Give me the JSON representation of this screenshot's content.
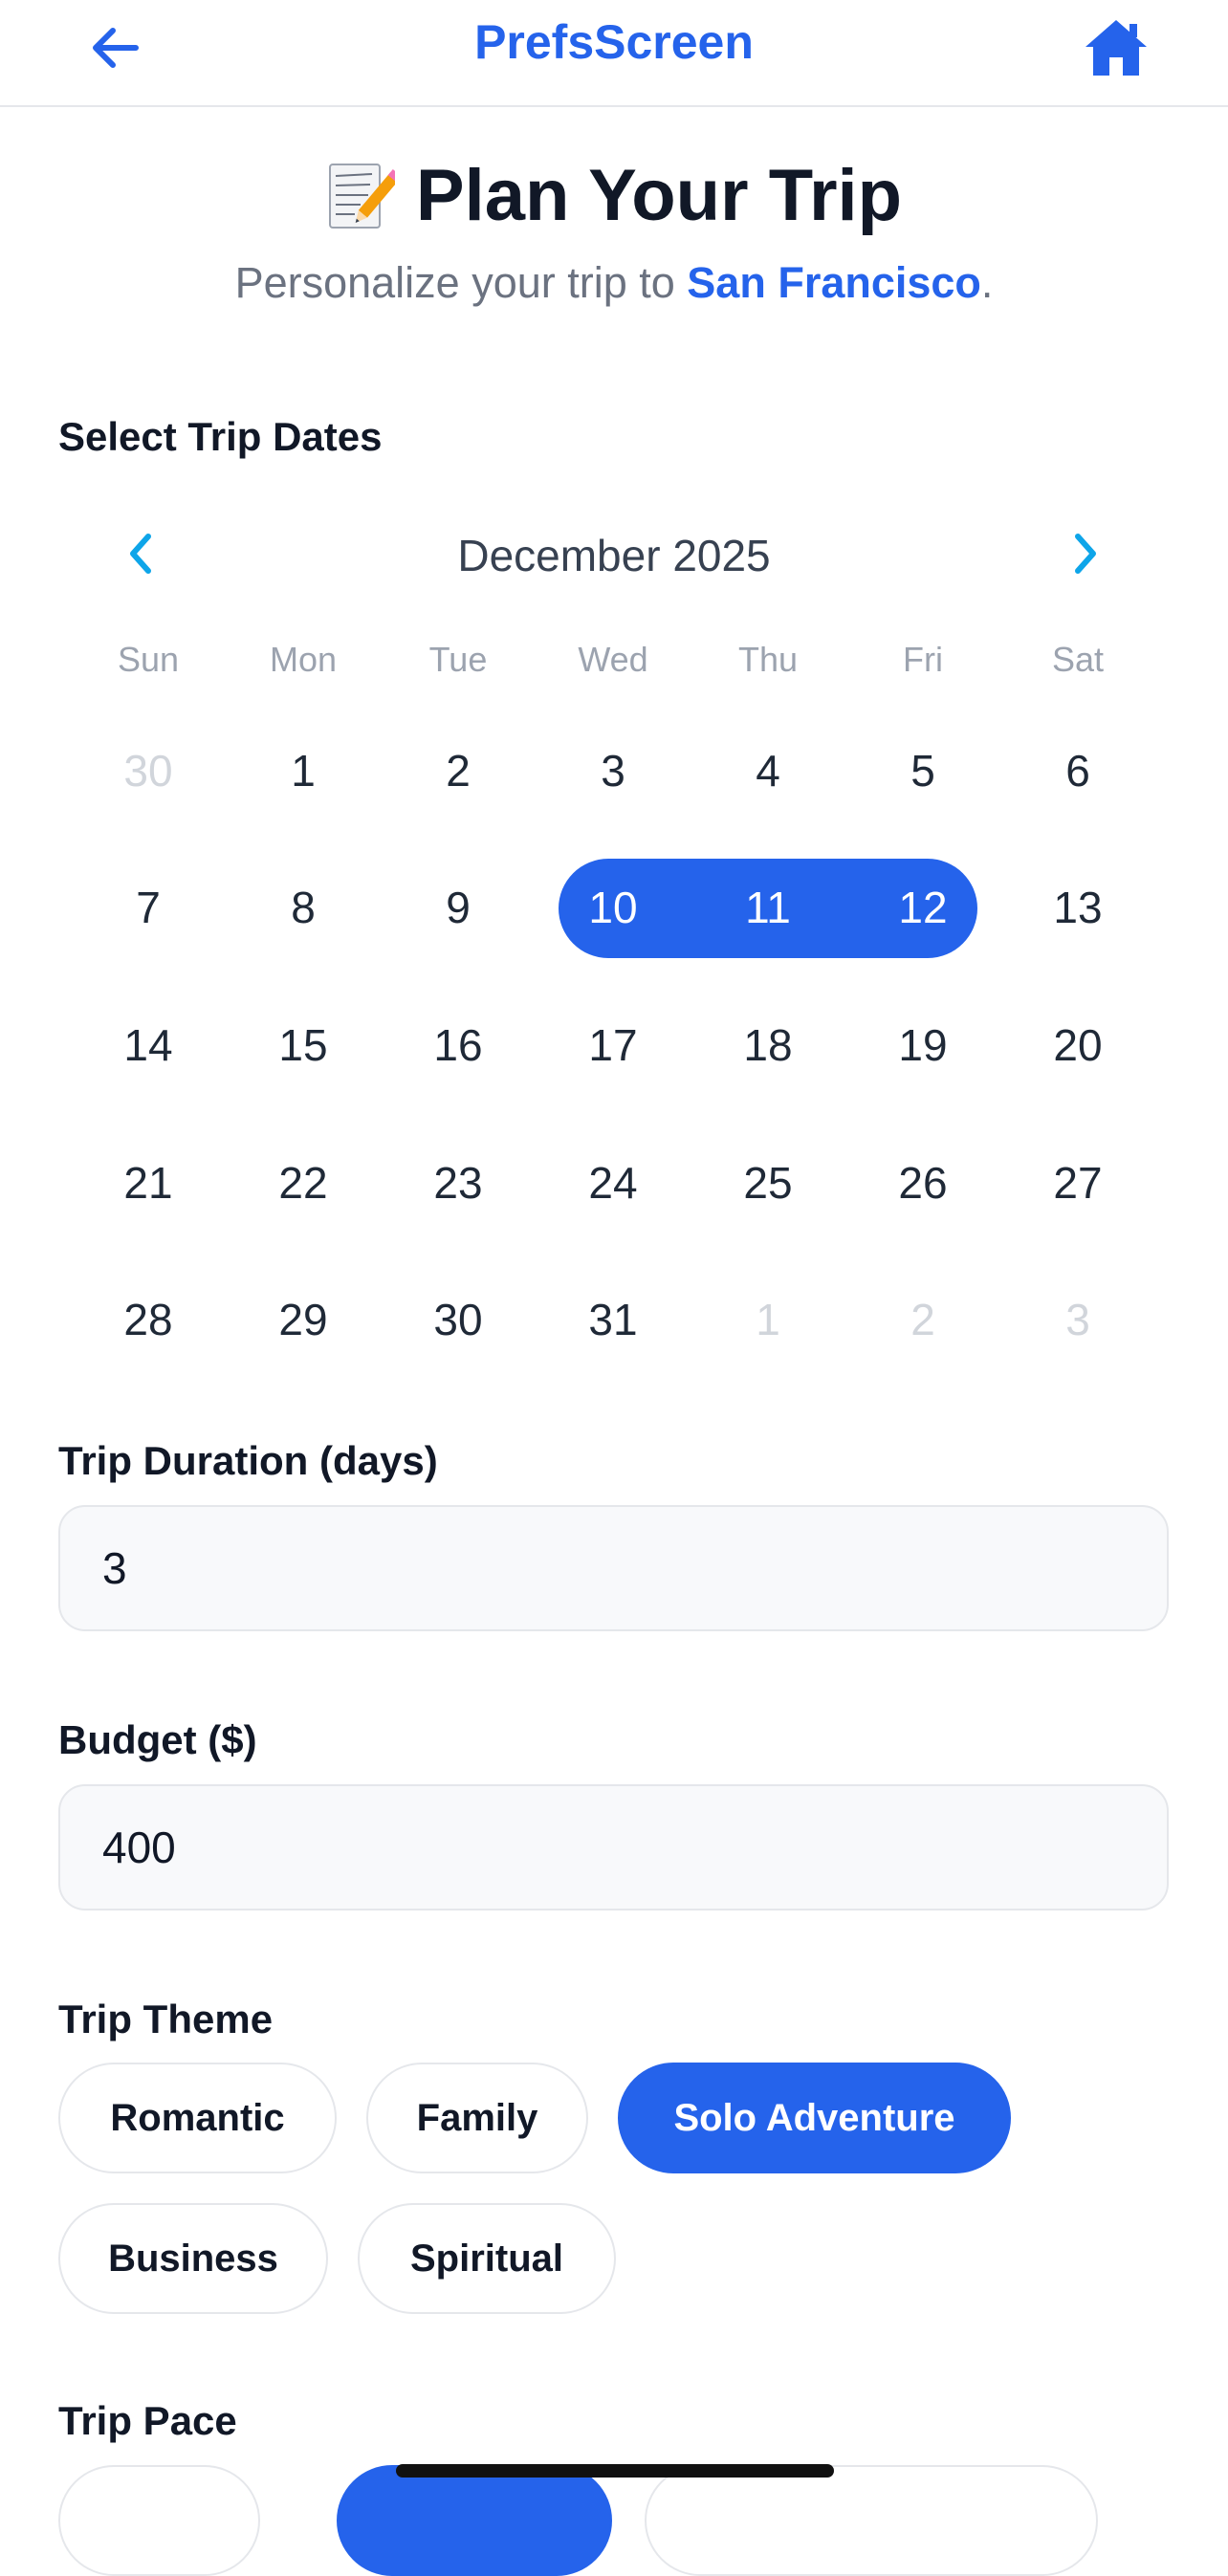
{
  "header": {
    "title": "PrefsScreen",
    "back_icon": "arrow-left-icon",
    "home_icon": "home-icon",
    "accent_color": "#2563eb"
  },
  "intro": {
    "emoji": "memo-icon",
    "title": "Plan Your Trip",
    "subtitle_prefix": "Personalize your trip to ",
    "city": "San Francisco",
    "subtitle_suffix": "."
  },
  "dates": {
    "label": "Select Trip Dates",
    "month": "December 2025",
    "weekdays": [
      "Sun",
      "Mon",
      "Tue",
      "Wed",
      "Thu",
      "Fri",
      "Sat"
    ],
    "weeks": [
      [
        "30",
        "1",
        "2",
        "3",
        "4",
        "5",
        "6"
      ],
      [
        "7",
        "8",
        "9",
        "10",
        "11",
        "12",
        "13"
      ],
      [
        "14",
        "15",
        "16",
        "17",
        "18",
        "19",
        "20"
      ],
      [
        "21",
        "22",
        "23",
        "24",
        "25",
        "26",
        "27"
      ],
      [
        "28",
        "29",
        "30",
        "31",
        "1",
        "2",
        "3"
      ]
    ],
    "selected": [
      "10",
      "11",
      "12"
    ],
    "selected_color": "#2563eb"
  },
  "duration": {
    "label": "Trip Duration (days)",
    "value": "3"
  },
  "budget": {
    "label": "Budget ($)",
    "value": "400"
  },
  "theme": {
    "label": "Trip Theme",
    "options": [
      "Romantic",
      "Family",
      "Solo Adventure",
      "Business",
      "Spiritual"
    ],
    "selected": "Solo Adventure"
  },
  "pace": {
    "label": "Trip Pace"
  }
}
